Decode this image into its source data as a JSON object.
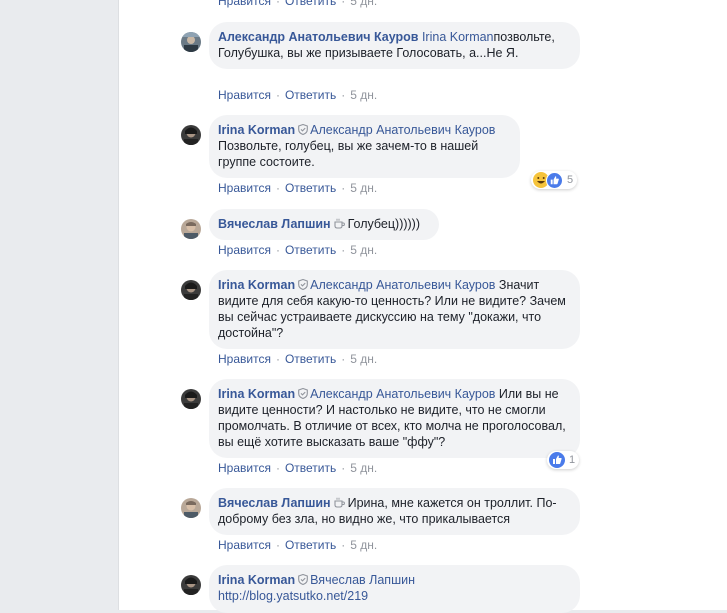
{
  "actions": {
    "like": "Нравится",
    "reply": "Ответить",
    "time": "5 дн."
  },
  "colors": {
    "link": "#385898",
    "bubble": "#f2f3f5",
    "meta": "#90949c",
    "like_blue": "#4a7bea",
    "haha_yellow": "#f5c33b"
  },
  "icons": {
    "admin_badge": "shield-icon",
    "coffee_badge": "coffee-cup-icon"
  },
  "comments": [
    {
      "author": "Александр Анатольевич Кауров",
      "tag": "Irina Korman",
      "text": "позвольте, Голубушка, вы же призываете Голосовать, а...Не Я."
    },
    {
      "author": "Irina Korman",
      "tag": "Александр Анатольевич Кауров",
      "text": "Позвольте, голубец, вы же зачем-то в нашей группе состоите.",
      "reactions": {
        "types": [
          "haha",
          "like"
        ],
        "count": "5"
      }
    },
    {
      "author": "Вячеслав Лапшин",
      "text": "Голубец))))))"
    },
    {
      "author": "Irina Korman",
      "tag": "Александр Анатольевич Кауров",
      "text": "Значит видите для себя какую-то ценность? Или не видите? Зачем вы сейчас устраиваете дискуссию на тему \"докажи, что достойна\"?"
    },
    {
      "author": "Irina Korman",
      "tag": "Александр Анатольевич Кауров",
      "text": "Или вы не видите ценности? И настолько не видите, что не смогли промолчать. В отличие от всех, кто молча не проголосовал, вы ещё хотите высказать ваше \"ффу\"?",
      "reactions": {
        "types": [
          "like"
        ],
        "count": "1"
      }
    },
    {
      "author": "Вячеслав Лапшин",
      "text": "Ирина, мне кажется он троллит. По-доброму без зла, но видно же, что прикалывается"
    },
    {
      "author": "Irina Korman",
      "tag": "Вячеслав Лапшин",
      "link": "http://blog.yatsutko.net/219"
    }
  ]
}
